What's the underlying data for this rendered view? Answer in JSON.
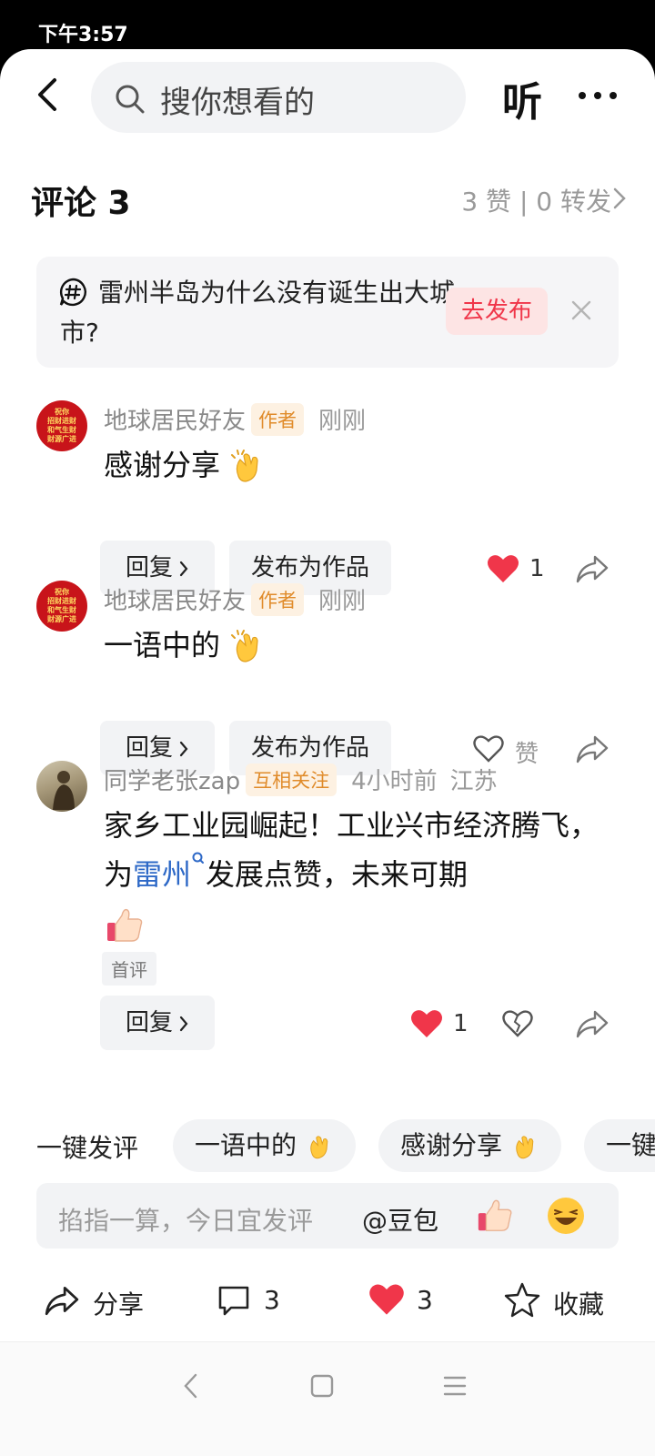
{
  "status": {
    "time": "下午3:57"
  },
  "header": {
    "search_placeholder": "搜你想看的",
    "listen_label": "听"
  },
  "comments_header": {
    "title": "评论 3",
    "stats": "3 赞 | 0 转发"
  },
  "topic": {
    "text": "雷州半岛为什么没有诞生出大城市?",
    "button": "去发布"
  },
  "comments": [
    {
      "name": "地球居民好友",
      "badge": "作者",
      "time": "刚刚",
      "text": "感谢分享",
      "reply": "回复",
      "publish": "发布为作品",
      "likes": "1"
    },
    {
      "name": "地球居民好友",
      "badge": "作者",
      "time": "刚刚",
      "text": "一语中的",
      "reply": "回复",
      "publish": "发布为作品",
      "like_label": "赞"
    },
    {
      "name": "同学老张zap",
      "badge": "互相关注",
      "time": "4小时前",
      "location": "江苏",
      "text_1": "家乡工业园崛起！工业兴市经济腾飞，为",
      "link": "雷州",
      "text_2": "发展点赞，未来可期",
      "tag": "首评",
      "reply": "回复",
      "likes": "1"
    }
  ],
  "quick_replies": {
    "label": "一键发评",
    "chips": [
      "一语中的",
      "感谢分享",
      "一键"
    ]
  },
  "input": {
    "placeholder": "掐指一算，今日宜发评",
    "mention": "@豆包"
  },
  "actions": {
    "share": "分享",
    "comments": "3",
    "likes": "3",
    "favorite": "收藏"
  },
  "colors": {
    "like_red": "#f0364a",
    "link_blue": "#2e69c7",
    "badge_orange": "#e08b2a"
  }
}
